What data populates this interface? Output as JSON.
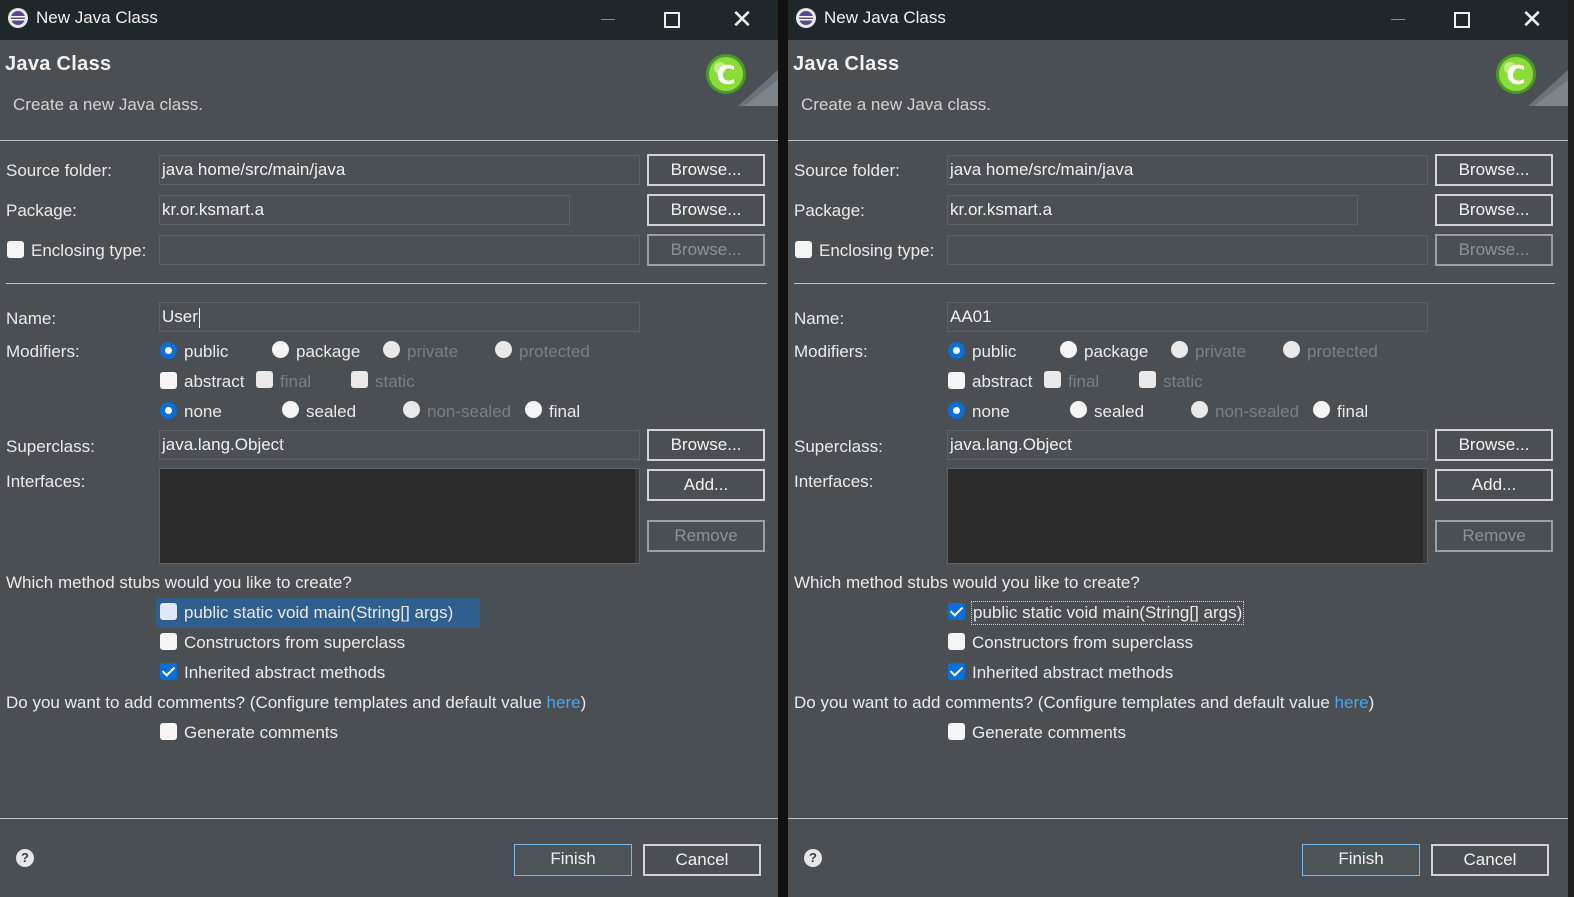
{
  "windows": [
    {
      "title": "New Java Class",
      "header": {
        "title": "Java Class",
        "description": "Create a new Java class."
      },
      "source_folder": {
        "label": "Source folder:",
        "value": "java home/src/main/java",
        "button": "Browse..."
      },
      "package": {
        "label": "Package:",
        "value": "kr.or.ksmart.a",
        "button": "Browse..."
      },
      "enclosing": {
        "label": "Enclosing type:",
        "value": "",
        "button": "Browse...",
        "checked": false
      },
      "name": {
        "label": "Name:",
        "value": "User"
      },
      "modifiers": {
        "label": "Modifiers:",
        "access": [
          "public",
          "package",
          "private",
          "protected"
        ],
        "access_selected": "public",
        "flags": [
          "abstract",
          "final",
          "static"
        ],
        "sealing": [
          "none",
          "sealed",
          "non-sealed",
          "final"
        ],
        "sealing_selected": "none"
      },
      "superclass": {
        "label": "Superclass:",
        "value": "java.lang.Object",
        "button": "Browse..."
      },
      "interfaces": {
        "label": "Interfaces:",
        "add_button": "Add...",
        "remove_button": "Remove"
      },
      "stubs": {
        "question": "Which method stubs would you like to create?",
        "main": {
          "label": "public static void main(String[] args)",
          "checked": false
        },
        "constructors": {
          "label": "Constructors from superclass",
          "checked": false
        },
        "inherited": {
          "label": "Inherited abstract methods",
          "checked": true
        }
      },
      "comments": {
        "question_pre": "Do you want to add comments? (Configure templates and default value ",
        "link": "here",
        "question_post": ")",
        "generate": {
          "label": "Generate comments",
          "checked": false
        }
      },
      "footer": {
        "help": "?",
        "finish": "Finish",
        "cancel": "Cancel"
      }
    },
    {
      "title": "New Java Class",
      "header": {
        "title": "Java Class",
        "description": "Create a new Java class."
      },
      "source_folder": {
        "label": "Source folder:",
        "value": "java home/src/main/java",
        "button": "Browse..."
      },
      "package": {
        "label": "Package:",
        "value": "kr.or.ksmart.a",
        "button": "Browse..."
      },
      "enclosing": {
        "label": "Enclosing type:",
        "value": "",
        "button": "Browse...",
        "checked": false
      },
      "name": {
        "label": "Name:",
        "value": "AA01"
      },
      "modifiers": {
        "label": "Modifiers:",
        "access": [
          "public",
          "package",
          "private",
          "protected"
        ],
        "access_selected": "public",
        "flags": [
          "abstract",
          "final",
          "static"
        ],
        "sealing": [
          "none",
          "sealed",
          "non-sealed",
          "final"
        ],
        "sealing_selected": "none"
      },
      "superclass": {
        "label": "Superclass:",
        "value": "java.lang.Object",
        "button": "Browse..."
      },
      "interfaces": {
        "label": "Interfaces:",
        "add_button": "Add...",
        "remove_button": "Remove"
      },
      "stubs": {
        "question": "Which method stubs would you like to create?",
        "main": {
          "label": "public static void main(String[] args)",
          "checked": true
        },
        "constructors": {
          "label": "Constructors from superclass",
          "checked": false
        },
        "inherited": {
          "label": "Inherited abstract methods",
          "checked": true
        }
      },
      "comments": {
        "question_pre": "Do you want to add comments? (Configure templates and default value ",
        "link": "here",
        "question_post": ")",
        "generate": {
          "label": "Generate comments",
          "checked": false
        }
      },
      "footer": {
        "help": "?",
        "finish": "Finish",
        "cancel": "Cancel"
      }
    }
  ],
  "colors": {
    "background": "#4a4f53",
    "titlebar": "#1f272b",
    "accent": "#0a6fd8",
    "link": "#4aa3f0"
  },
  "icons": [
    "eclipse-icon",
    "minimize-icon",
    "maximize-icon",
    "close-icon",
    "java-class-icon",
    "help-icon"
  ]
}
